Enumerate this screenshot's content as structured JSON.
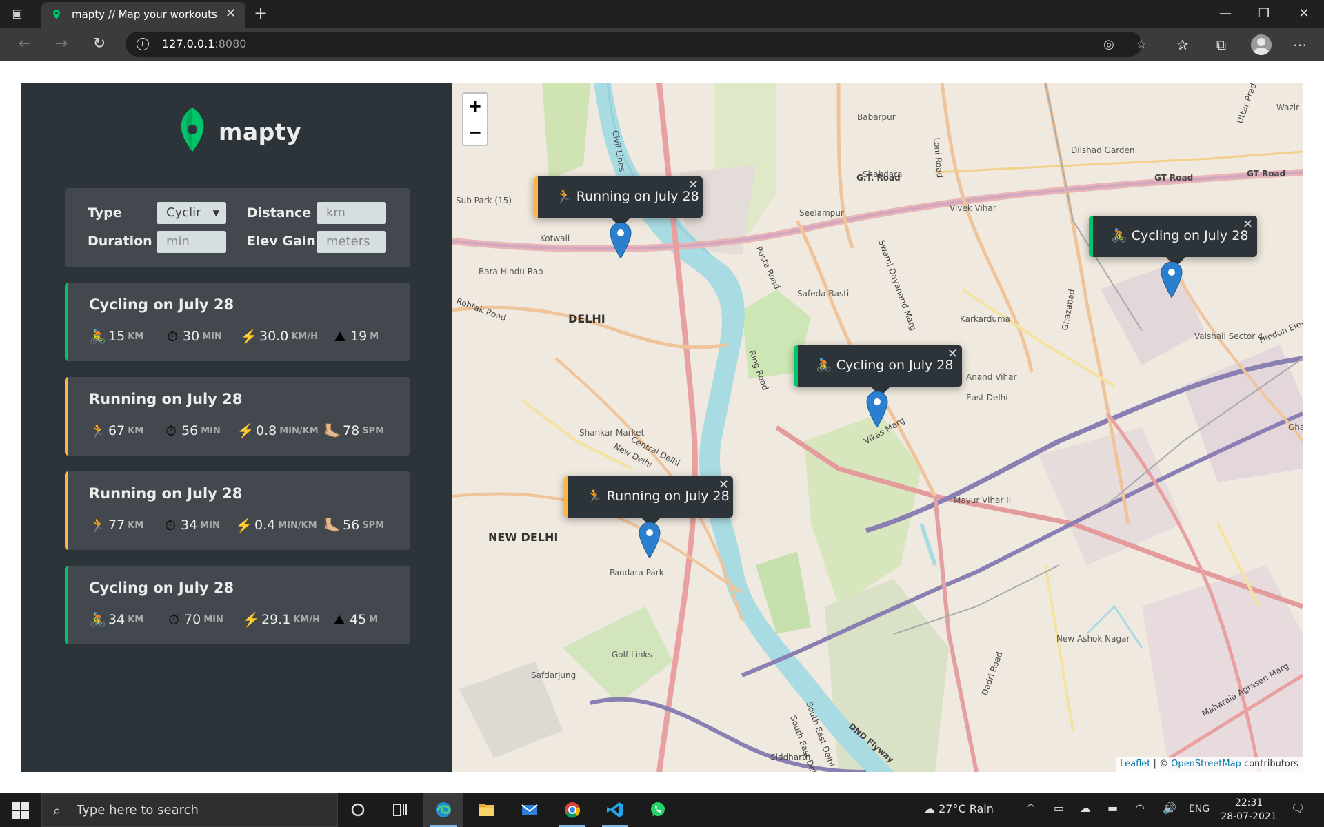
{
  "browser": {
    "tab_title": "mapty // Map your workouts",
    "new_tab_icon": "plus-icon",
    "url_host": "127.0.0.1",
    "url_port": ":8080"
  },
  "app": {
    "logo_text": "mapty",
    "form": {
      "type_label": "Type",
      "type_value": "Cyclir",
      "distance_label": "Distance",
      "distance_placeholder": "km",
      "duration_label": "Duration",
      "duration_placeholder": "min",
      "elev_label": "Elev Gain",
      "elev_placeholder": "meters"
    },
    "workouts": [
      {
        "type": "cycling",
        "title": "Cycling on July 28",
        "details": [
          {
            "icon": "🚴",
            "value": "15",
            "unit": "KM"
          },
          {
            "icon": "⏱",
            "value": "30",
            "unit": "MIN"
          },
          {
            "icon": "⚡️",
            "value": "30.0",
            "unit": "KM/H"
          },
          {
            "icon": "⛰",
            "value": "19",
            "unit": "M"
          }
        ]
      },
      {
        "type": "running",
        "title": "Running on July 28",
        "details": [
          {
            "icon": "🏃",
            "value": "67",
            "unit": "KM"
          },
          {
            "icon": "⏱",
            "value": "56",
            "unit": "MIN"
          },
          {
            "icon": "⚡️",
            "value": "0.8",
            "unit": "MIN/KM"
          },
          {
            "icon": "🦶🏼",
            "value": "78",
            "unit": "SPM"
          }
        ]
      },
      {
        "type": "running",
        "title": "Running on July 28",
        "details": [
          {
            "icon": "🏃",
            "value": "77",
            "unit": "KM"
          },
          {
            "icon": "⏱",
            "value": "34",
            "unit": "MIN"
          },
          {
            "icon": "⚡️",
            "value": "0.4",
            "unit": "MIN/KM"
          },
          {
            "icon": "🦶🏼",
            "value": "56",
            "unit": "SPM"
          }
        ]
      },
      {
        "type": "cycling",
        "title": "Cycling on July 28",
        "details": [
          {
            "icon": "🚴",
            "value": "34",
            "unit": "KM"
          },
          {
            "icon": "⏱",
            "value": "70",
            "unit": "MIN"
          },
          {
            "icon": "⚡️",
            "value": "29.1",
            "unit": "KM/H"
          },
          {
            "icon": "⛰",
            "value": "45",
            "unit": "M"
          }
        ]
      }
    ]
  },
  "map": {
    "zoom_in": "+",
    "zoom_out": "−",
    "popups": [
      {
        "type": "running",
        "icon": "🏃",
        "text": "Running on July 28"
      },
      {
        "type": "cycling",
        "icon": "🚴",
        "text": "Cycling on July 28"
      },
      {
        "type": "cycling",
        "icon": "🚴",
        "text": "Cycling on July 28"
      },
      {
        "type": "running",
        "icon": "🏃",
        "text": "Running on July 28"
      }
    ],
    "places": [
      "DELHI",
      "NEW DELHI",
      "Babarpur",
      "Seelampur",
      "Shahdara",
      "Vivek Vihar",
      "Dilshad Garden",
      "Karkarduma",
      "Vaishali Sector 4",
      "Anand Vihar",
      "East Delhi",
      "Mayur Vihar II",
      "New Ashok Nagar",
      "Pandara Park",
      "Golf Links",
      "Safdarjung",
      "Shankar Market",
      "Bara Hindu Rao",
      "Sub Park (15)",
      "Safeda Basti",
      "Wazir",
      "Kotwali",
      "Ghazi"
    ],
    "roads": [
      "GT Road",
      "G.T. Road",
      "Loni Road",
      "Pusta Road",
      "Ring Road",
      "Vikas Marg",
      "Central Delhi",
      "New Delhi",
      "South East Delhi",
      "DND Flyway",
      "Maharaja Agrasen Marg",
      "Hindon Elevated",
      "Swami Dayanand Marg",
      "Rohtak Road",
      "Civil Lines",
      "Uttar Pradesh",
      "South East Delhi",
      "Dadri Road",
      "Siddharth",
      "Ghazabad"
    ],
    "attribution": {
      "leaflet": "Leaflet",
      "sep": " | © ",
      "osm": "OpenStreetMap",
      "suffix": " contributors"
    }
  },
  "taskbar": {
    "search_placeholder": "Type here to search",
    "weather": "27°C  Rain",
    "lang": "ENG",
    "time": "22:31",
    "date": "28-07-2021"
  },
  "colors": {
    "cycling": "#00c46a",
    "running": "#ffb545",
    "sidebar": "#2d3439",
    "card": "#42484d"
  }
}
